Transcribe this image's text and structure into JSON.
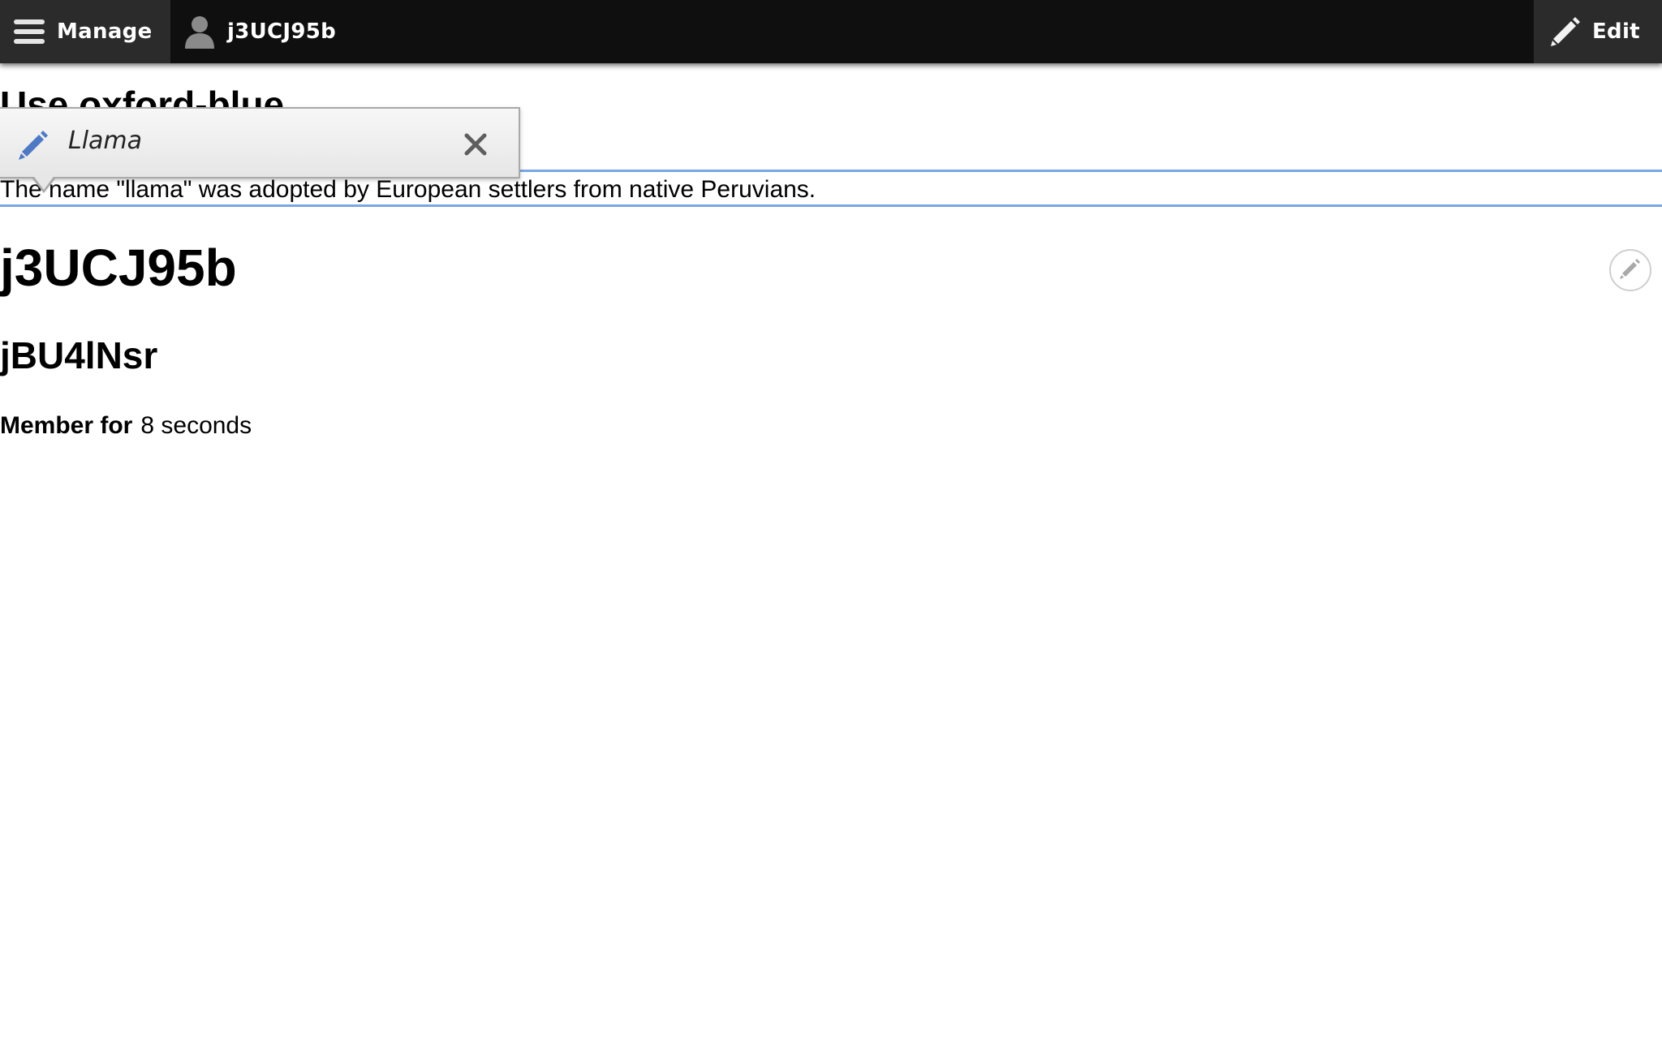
{
  "toolbar": {
    "manage_label": "Manage",
    "user_label": "j3UCJ95b",
    "edit_label": "Edit"
  },
  "page": {
    "hidden_title": "Use oxford-blue",
    "field_text": "The name \"llama\" was adopted by European settlers from native Peruvians.",
    "user_name": "j3UCJ95b",
    "sub_name": "jBU4lNsr",
    "member_label": "Member for",
    "member_value": "8 seconds"
  },
  "quickedit": {
    "label": "Llama"
  },
  "colors": {
    "toolbar_bg": "#0f0f0f",
    "toolbar_tab_bg": "#2b2b2b",
    "field_outline": "#79a7e6",
    "pencil_blue": "#4f79c4"
  },
  "icons": {
    "menu": "hamburger-icon",
    "user": "user-icon",
    "edit": "pencil-icon",
    "close": "close-icon",
    "contextual": "pencil-icon"
  }
}
